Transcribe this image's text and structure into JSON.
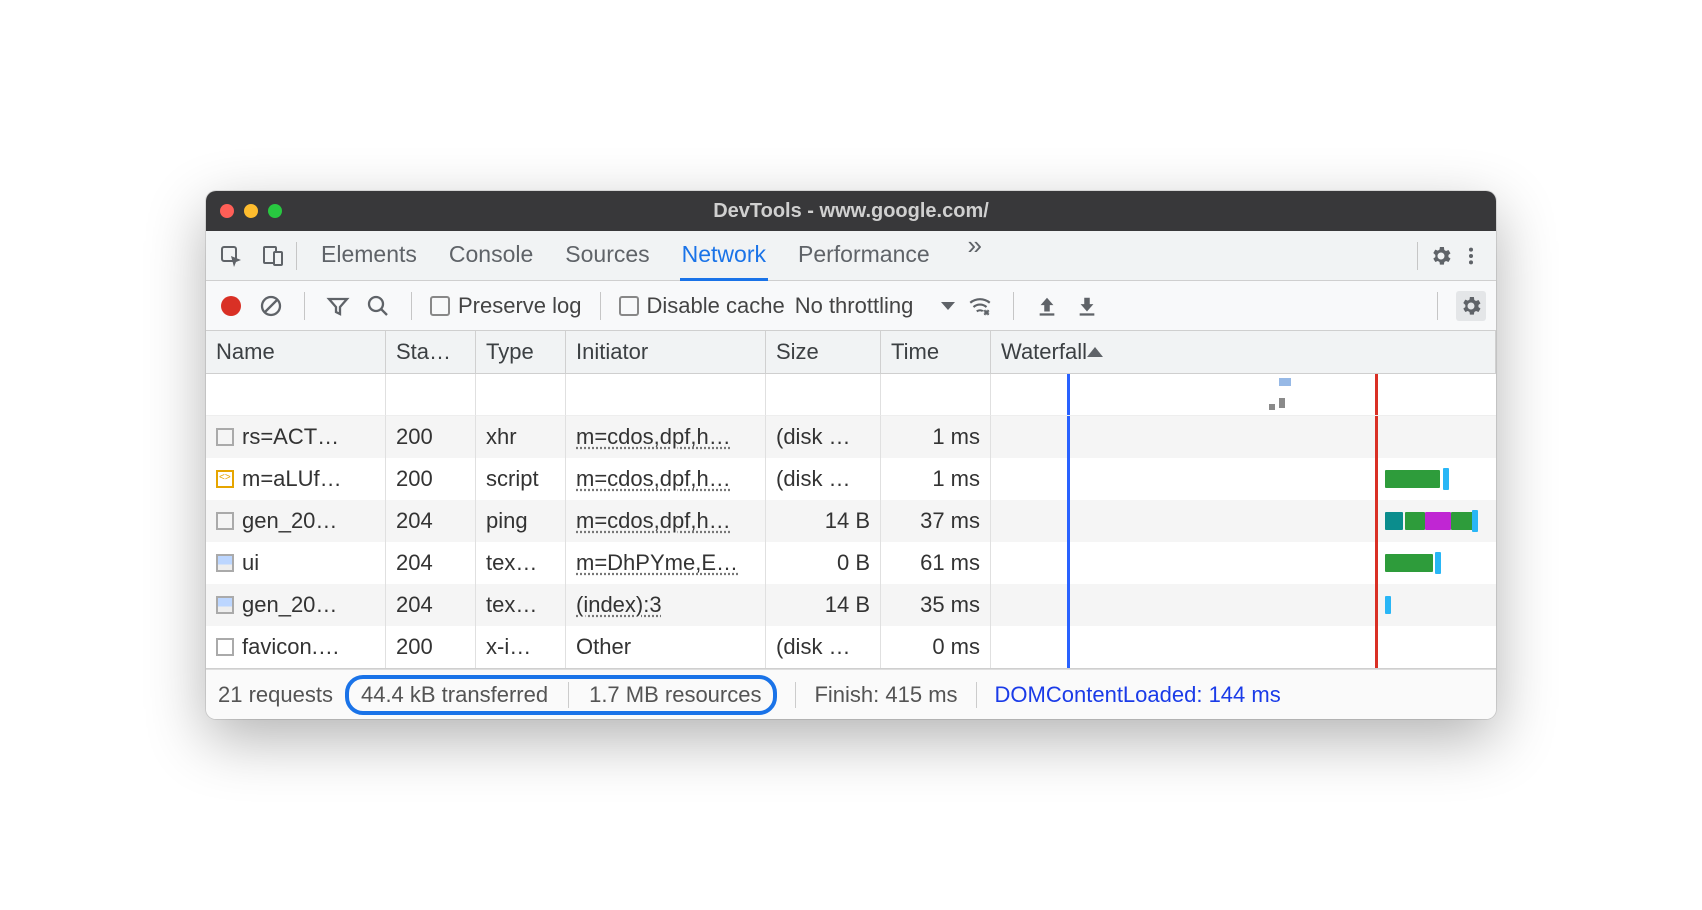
{
  "window": {
    "title": "DevTools - www.google.com/"
  },
  "tabs": {
    "items": [
      "Elements",
      "Console",
      "Sources",
      "Network",
      "Performance"
    ],
    "active_index": 3
  },
  "toolbar": {
    "preserve_log_label": "Preserve log",
    "disable_cache_label": "Disable cache",
    "throttling_label": "No throttling"
  },
  "columns": {
    "name": "Name",
    "status": "Sta…",
    "type": "Type",
    "initiator": "Initiator",
    "size": "Size",
    "time": "Time",
    "waterfall": "Waterfall"
  },
  "rows": [
    {
      "icon": "doc",
      "name": "rs=ACT…",
      "status": "200",
      "type": "xhr",
      "initiator": "m=cdos,dpf,h…",
      "size": "(disk …",
      "time": "1 ms"
    },
    {
      "icon": "js",
      "name": "m=aLUf…",
      "status": "200",
      "type": "script",
      "initiator": "m=cdos,dpf,h…",
      "size": "(disk …",
      "time": "1 ms"
    },
    {
      "icon": "doc",
      "name": "gen_20…",
      "status": "204",
      "type": "ping",
      "initiator": "m=cdos,dpf,h…",
      "size": "14 B",
      "time": "37 ms"
    },
    {
      "icon": "img",
      "name": "ui",
      "status": "204",
      "type": "tex…",
      "initiator": "m=DhPYme,E…",
      "size": "0 B",
      "time": "61 ms"
    },
    {
      "icon": "img",
      "name": "gen_20…",
      "status": "204",
      "type": "tex…",
      "initiator": "(index):3",
      "size": "14 B",
      "time": "35 ms"
    },
    {
      "icon": "doc",
      "name": "favicon.…",
      "status": "200",
      "type": "x-i…",
      "initiator": "Other",
      "size": "(disk …",
      "time": "0 ms"
    }
  ],
  "footer": {
    "requests": "21 requests",
    "transferred": "44.4 kB transferred",
    "resources": "1.7 MB resources",
    "finish": "Finish: 415 ms",
    "dcl": "DOMContentLoaded: 144 ms"
  }
}
